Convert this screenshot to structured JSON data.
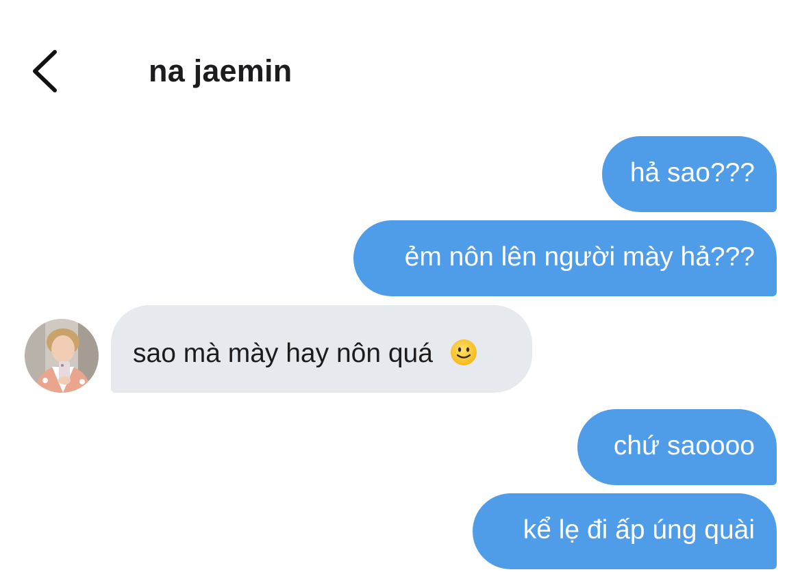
{
  "header": {
    "title": "na jaemin",
    "back_icon": "chevron-left-icon"
  },
  "messages": [
    {
      "direction": "outgoing",
      "text": "hả sao???"
    },
    {
      "direction": "outgoing",
      "text": "ẻm nôn lên người mày hả???"
    },
    {
      "direction": "incoming",
      "text": "sao mà mày hay nôn quá",
      "emoji": "slightly-smiling-face-icon"
    },
    {
      "direction": "outgoing",
      "text": "chứ saoooo"
    },
    {
      "direction": "outgoing",
      "text": "kể lẹ đi ấp úng quài"
    }
  ],
  "colors": {
    "outgoing_bubble": "#4f9de9",
    "incoming_bubble": "#e6e9ee",
    "title": "#1c1c1e"
  }
}
